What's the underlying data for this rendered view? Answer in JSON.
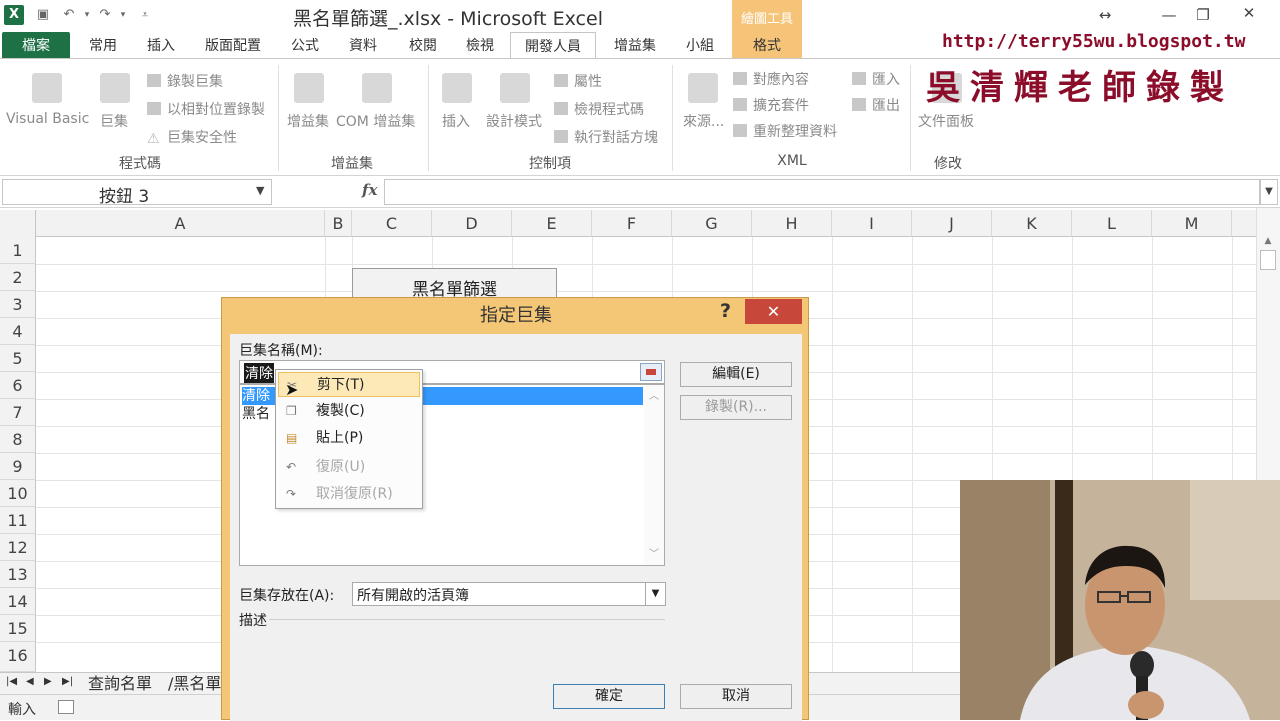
{
  "window": {
    "title": "黑名單篩選_.xlsx - Microsoft Excel",
    "contextual_group": "繪圖工具"
  },
  "ribbon_tabs": [
    "檔案",
    "常用",
    "插入",
    "版面配置",
    "公式",
    "資料",
    "校閱",
    "檢視",
    "開發人員",
    "增益集",
    "小組",
    "格式"
  ],
  "active_tab": "開發人員",
  "ribbon": {
    "groups": {
      "code": {
        "label": "程式碼",
        "visual_basic": "Visual Basic",
        "macros": "巨集",
        "record_macro": "錄製巨集",
        "relative_ref": "以相對位置錄製",
        "macro_security": "巨集安全性"
      },
      "addins": {
        "label": "增益集",
        "addins": "增益集",
        "com_addins": "COM 增益集"
      },
      "controls": {
        "label": "控制項",
        "insert": "插入",
        "design_mode": "設計模式",
        "properties": "屬性",
        "view_code": "檢視程式碼",
        "run_dialog": "執行對話方塊"
      },
      "xml": {
        "label": "XML",
        "source": "來源...",
        "map_properties": "對應內容",
        "expansion_packs": "擴充套件",
        "refresh_data": "重新整理資料",
        "import": "匯入",
        "export": "匯出"
      },
      "modify": {
        "label": "修改",
        "document_panel": "文件面板"
      }
    }
  },
  "formula_bar": {
    "name_box": "按鈕 3",
    "fx": "fx",
    "formula": ""
  },
  "grid": {
    "columns": [
      "A",
      "B",
      "C",
      "D",
      "E",
      "F",
      "G",
      "H",
      "I",
      "J",
      "K",
      "L",
      "M"
    ],
    "rows": [
      "1",
      "2",
      "3",
      "4",
      "5",
      "6",
      "7",
      "8",
      "9",
      "10",
      "11",
      "12",
      "13",
      "14",
      "15",
      "16"
    ],
    "sheet_button_label": "黑名單篩選"
  },
  "sheet_tabs": [
    "查詢名單",
    "黑名單"
  ],
  "status": {
    "mode": "輸入"
  },
  "dialog": {
    "title": "指定巨集",
    "help": "?",
    "close": "✕",
    "macro_name_label": "巨集名稱(M):",
    "macro_name_value": "清除",
    "macro_list": [
      "清除",
      "黑名"
    ],
    "edit_button": "編輯(E)",
    "record_button": "錄製(R)...",
    "store_in_label": "巨集存放在(A):",
    "store_in_value": "所有開啟的活頁簿",
    "description_label": "描述",
    "ok_button": "確定",
    "cancel_button": "取消"
  },
  "context_menu": {
    "items": [
      {
        "label": "剪下(T)",
        "icon": "cut-icon",
        "enabled": true
      },
      {
        "label": "複製(C)",
        "icon": "copy-icon",
        "enabled": true
      },
      {
        "label": "貼上(P)",
        "icon": "paste-icon",
        "enabled": true
      },
      {
        "label": "復原(U)",
        "icon": "undo-icon",
        "enabled": false
      },
      {
        "label": "取消復原(R)",
        "icon": "redo-icon",
        "enabled": false
      }
    ]
  },
  "watermark": {
    "url": "http://terry55wu.blogspot.tw",
    "name": "吳清輝老師錄製"
  },
  "colors": {
    "excel_green": "#1e7145",
    "dialog_frame": "#f4c776",
    "close_red": "#c7483a",
    "selection_blue": "#3399ff",
    "watermark_red": "#8b0d2a"
  }
}
